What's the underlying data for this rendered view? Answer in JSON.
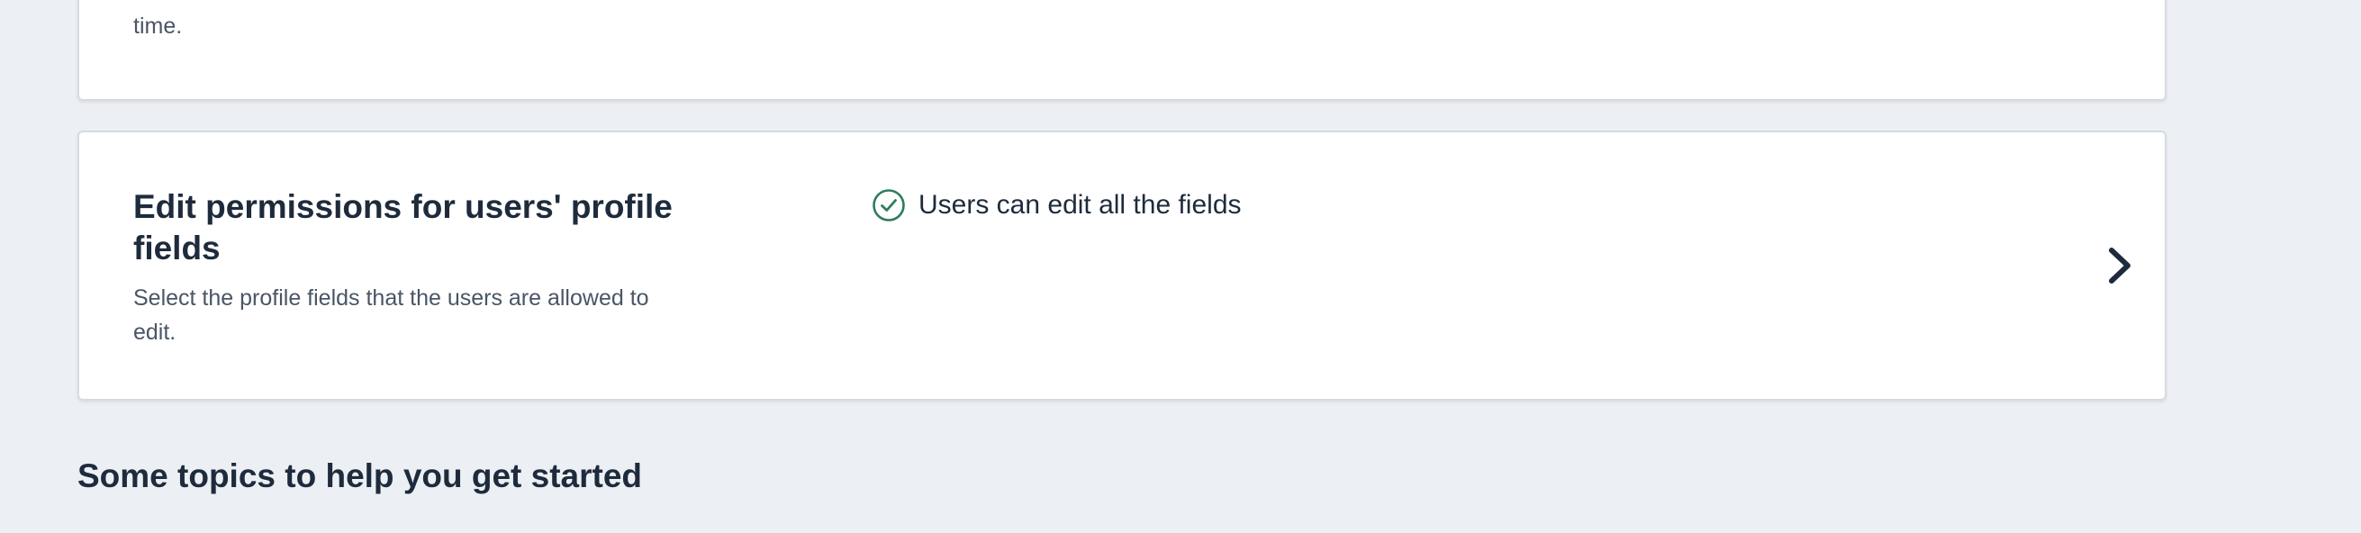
{
  "sessions_card": {
    "description": "the number of active sessions a user can have at a time."
  },
  "profile_fields_card": {
    "title": "Edit permissions for users' profile fields",
    "description": "Select the profile fields that the users are allowed to edit.",
    "status_icon": "check-circle-icon",
    "status_text": "Users can edit all the fields",
    "action_icon": "chevron-right-icon",
    "colors": {
      "status_icon": "#2e7d5b",
      "chevron": "#1e2b3c"
    }
  },
  "topics": {
    "heading": "Some topics to help you get started"
  }
}
